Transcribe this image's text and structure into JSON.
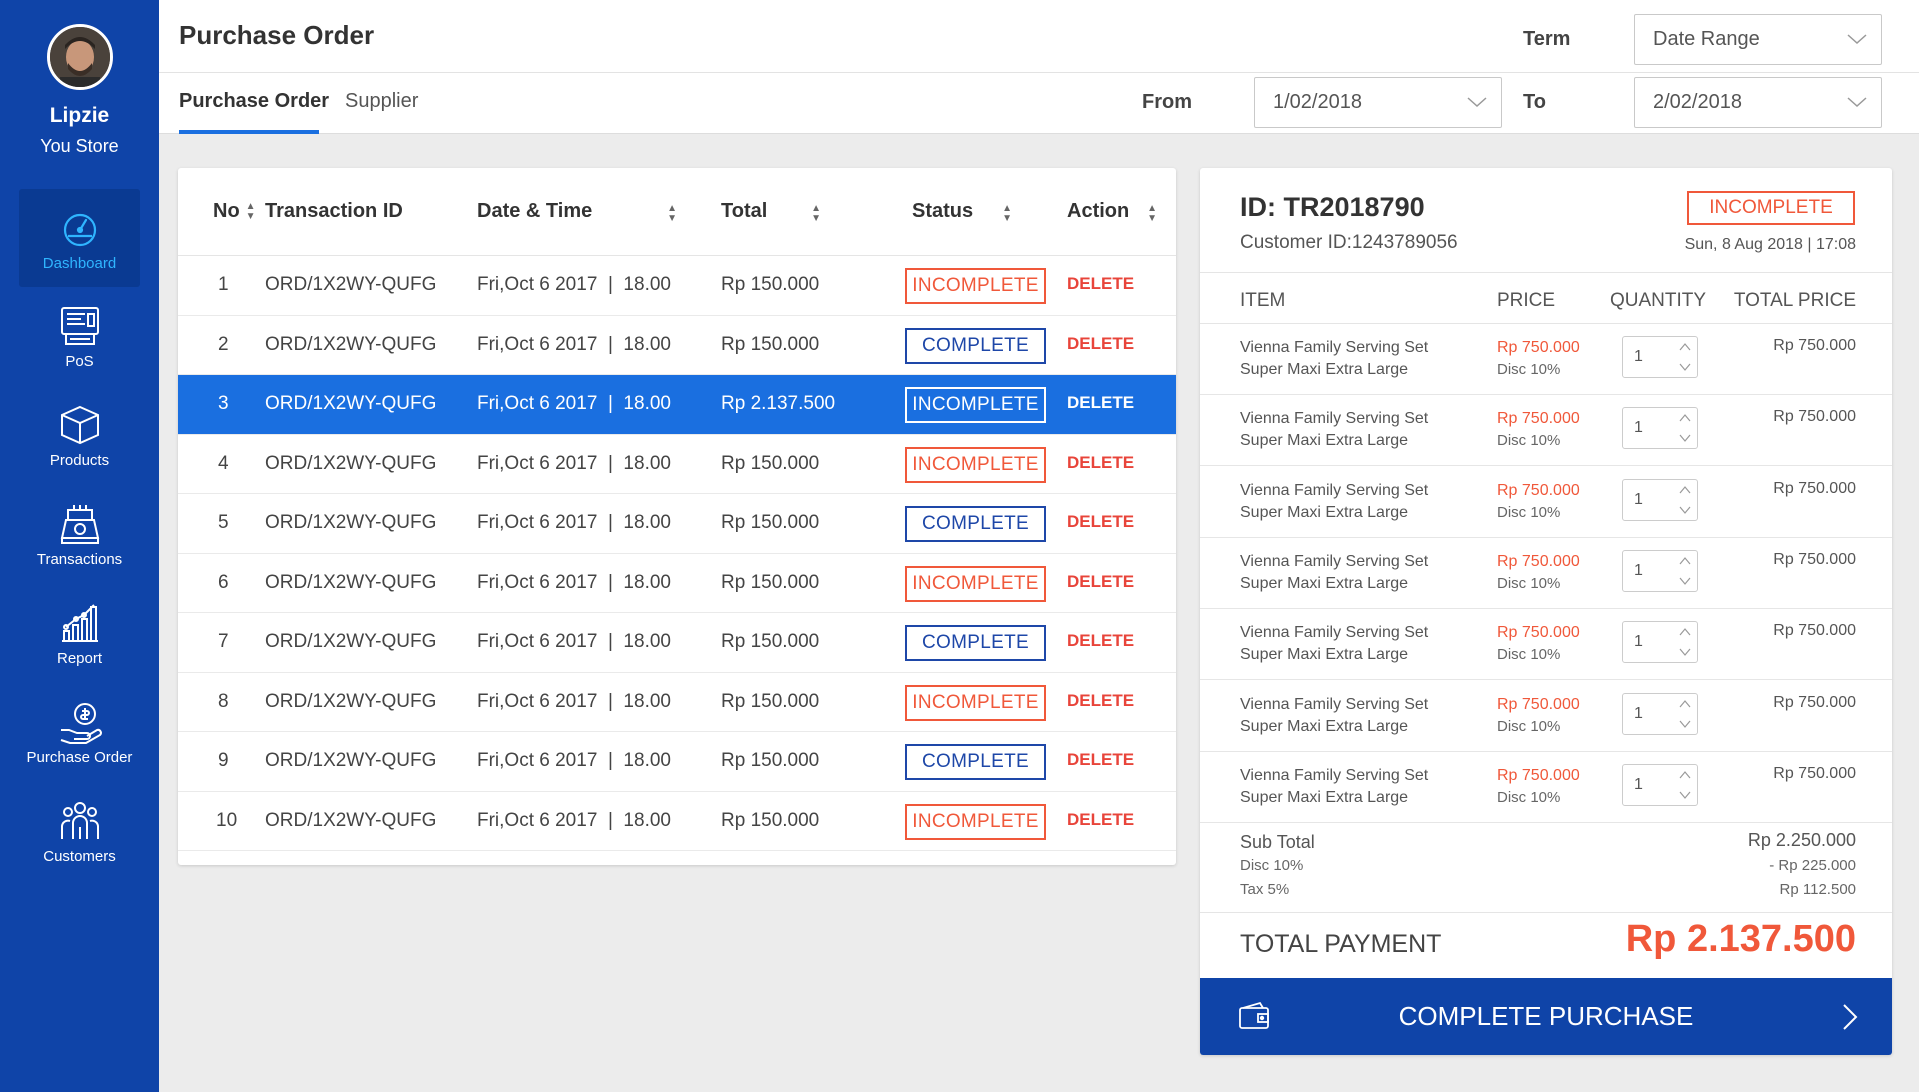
{
  "profile": {
    "name": "Lipzie",
    "store": "You Store"
  },
  "sidebar": {
    "items": [
      {
        "label": "Dashboard",
        "icon": "dashboard-icon",
        "active": true
      },
      {
        "label": "PoS",
        "icon": "pos-icon"
      },
      {
        "label": "Products",
        "icon": "box-icon"
      },
      {
        "label": "Transactions",
        "icon": "transactions-icon"
      },
      {
        "label": "Report",
        "icon": "report-icon"
      },
      {
        "label": "Purchase Order",
        "icon": "purchase-order-icon"
      },
      {
        "label": "Customers",
        "icon": "customers-icon"
      }
    ]
  },
  "header": {
    "title": "Purchase Order",
    "tabs": [
      "Purchase Order",
      "Supplier"
    ],
    "term_label": "Term",
    "term_value": "Date Range",
    "from_label": "From",
    "from_value": "1/02/2018",
    "to_label": "To",
    "to_value": "2/02/2018"
  },
  "table": {
    "columns": [
      "No",
      "Transaction ID",
      "Date & Time",
      "Total",
      "Status",
      "Action"
    ],
    "rows": [
      {
        "no": "1",
        "id": "ORD/1X2WY-QUFG",
        "date": "Fri,Oct 6 2017  |  18.00",
        "total": "Rp 150.000",
        "status": "INCOMPLETE",
        "action": "DELETE"
      },
      {
        "no": "2",
        "id": "ORD/1X2WY-QUFG",
        "date": "Fri,Oct 6 2017  |  18.00",
        "total": "Rp 150.000",
        "status": "COMPLETE",
        "action": "DELETE"
      },
      {
        "no": "3",
        "id": "ORD/1X2WY-QUFG",
        "date": "Fri,Oct 6 2017  |  18.00",
        "total": "Rp 2.137.500",
        "status": "INCOMPLETE",
        "action": "DELETE"
      },
      {
        "no": "4",
        "id": "ORD/1X2WY-QUFG",
        "date": "Fri,Oct 6 2017  |  18.00",
        "total": "Rp 150.000",
        "status": "INCOMPLETE",
        "action": "DELETE"
      },
      {
        "no": "5",
        "id": "ORD/1X2WY-QUFG",
        "date": "Fri,Oct 6 2017  |  18.00",
        "total": "Rp 150.000",
        "status": "COMPLETE",
        "action": "DELETE"
      },
      {
        "no": "6",
        "id": "ORD/1X2WY-QUFG",
        "date": "Fri,Oct 6 2017  |  18.00",
        "total": "Rp 150.000",
        "status": "INCOMPLETE",
        "action": "DELETE"
      },
      {
        "no": "7",
        "id": "ORD/1X2WY-QUFG",
        "date": "Fri,Oct 6 2017  |  18.00",
        "total": "Rp 150.000",
        "status": "COMPLETE",
        "action": "DELETE"
      },
      {
        "no": "8",
        "id": "ORD/1X2WY-QUFG",
        "date": "Fri,Oct 6 2017  |  18.00",
        "total": "Rp 150.000",
        "status": "INCOMPLETE",
        "action": "DELETE"
      },
      {
        "no": "9",
        "id": "ORD/1X2WY-QUFG",
        "date": "Fri,Oct 6 2017  |  18.00",
        "total": "Rp 150.000",
        "status": "COMPLETE",
        "action": "DELETE"
      },
      {
        "no": "10",
        "id": "ORD/1X2WY-QUFG",
        "date": "Fri,Oct 6 2017  |  18.00",
        "total": "Rp 150.000",
        "status": "INCOMPLETE",
        "action": "DELETE"
      }
    ]
  },
  "detail": {
    "id": "ID: TR2018790",
    "customer": "Customer ID:1243789056",
    "status": "INCOMPLETE",
    "datetime": "Sun, 8 Aug 2018  |  17:08",
    "columns": [
      "ITEM",
      "PRICE",
      "QUANTITY",
      "TOTAL PRICE"
    ],
    "items": [
      {
        "name1": "Vienna Family Serving Set",
        "name2": "Super Maxi Extra Large",
        "price": "Rp 750.000",
        "disc": "Disc 10%",
        "qty": "1",
        "total": "Rp 750.000"
      },
      {
        "name1": "Vienna Family Serving Set",
        "name2": "Super Maxi Extra Large",
        "price": "Rp 750.000",
        "disc": "Disc 10%",
        "qty": "1",
        "total": "Rp 750.000"
      },
      {
        "name1": "Vienna Family Serving Set",
        "name2": "Super Maxi Extra Large",
        "price": "Rp 750.000",
        "disc": "Disc 10%",
        "qty": "1",
        "total": "Rp 750.000"
      },
      {
        "name1": "Vienna Family Serving Set",
        "name2": "Super Maxi Extra Large",
        "price": "Rp 750.000",
        "disc": "Disc 10%",
        "qty": "1",
        "total": "Rp 750.000"
      },
      {
        "name1": "Vienna Family Serving Set",
        "name2": "Super Maxi Extra Large",
        "price": "Rp 750.000",
        "disc": "Disc 10%",
        "qty": "1",
        "total": "Rp 750.000"
      },
      {
        "name1": "Vienna Family Serving Set",
        "name2": "Super Maxi Extra Large",
        "price": "Rp 750.000",
        "disc": "Disc 10%",
        "qty": "1",
        "total": "Rp 750.000"
      },
      {
        "name1": "Vienna Family Serving Set",
        "name2": "Super Maxi Extra Large",
        "price": "Rp 750.000",
        "disc": "Disc 10%",
        "qty": "1",
        "total": "Rp 750.000"
      }
    ],
    "subtotal_label": "Sub Total",
    "subtotal_value": "Rp 2.250.000",
    "disc_label": "Disc 10%",
    "disc_value": "- Rp 225.000",
    "tax_label": "Tax 5%",
    "tax_value": "Rp 112.500",
    "total_label": "TOTAL PAYMENT",
    "total_value": "Rp 2.137.500",
    "cta_label": "COMPLETE PURCHASE"
  },
  "colors": {
    "brand": "#0f44a8",
    "accent": "#1a6fe0",
    "danger": "#f0583a"
  }
}
